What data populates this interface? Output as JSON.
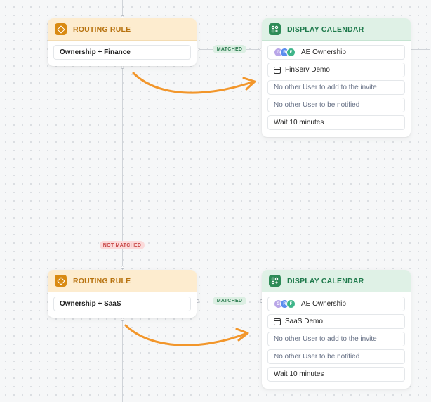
{
  "colors": {
    "accent_orange": "#f2962b",
    "rule_header": "#fdeccf",
    "calendar_header": "#dff1e6",
    "matched_pill": "#dcefe3",
    "not_matched_pill": "#fbdada"
  },
  "flow": {
    "blocks": [
      {
        "routing_rule": {
          "header": "ROUTING RULE",
          "condition": "Ownership + Finance"
        },
        "edge_label": "MATCHED",
        "display_calendar": {
          "header": "DISPLAY CALENDAR",
          "team": "AE Ownership",
          "avatars": [
            {
              "initial": "G"
            },
            {
              "initial": "R"
            },
            {
              "initial": "F"
            }
          ],
          "event": "FinServ Demo",
          "invite_text": "No other User to add to the invite",
          "notify_text": "No other User to be notified",
          "wait_text": "Wait 10 minutes"
        }
      },
      {
        "routing_rule": {
          "header": "ROUTING RULE",
          "condition": "Ownership + SaaS"
        },
        "edge_label": "MATCHED",
        "display_calendar": {
          "header": "DISPLAY CALENDAR",
          "team": "AE Ownership",
          "avatars": [
            {
              "initial": "G"
            },
            {
              "initial": "R"
            },
            {
              "initial": "F"
            }
          ],
          "event": "SaaS Demo",
          "invite_text": "No other User to add to the invite",
          "notify_text": "No other User to be notified",
          "wait_text": "Wait 10 minutes"
        }
      }
    ],
    "not_matched_label": "NOT MATCHED"
  }
}
